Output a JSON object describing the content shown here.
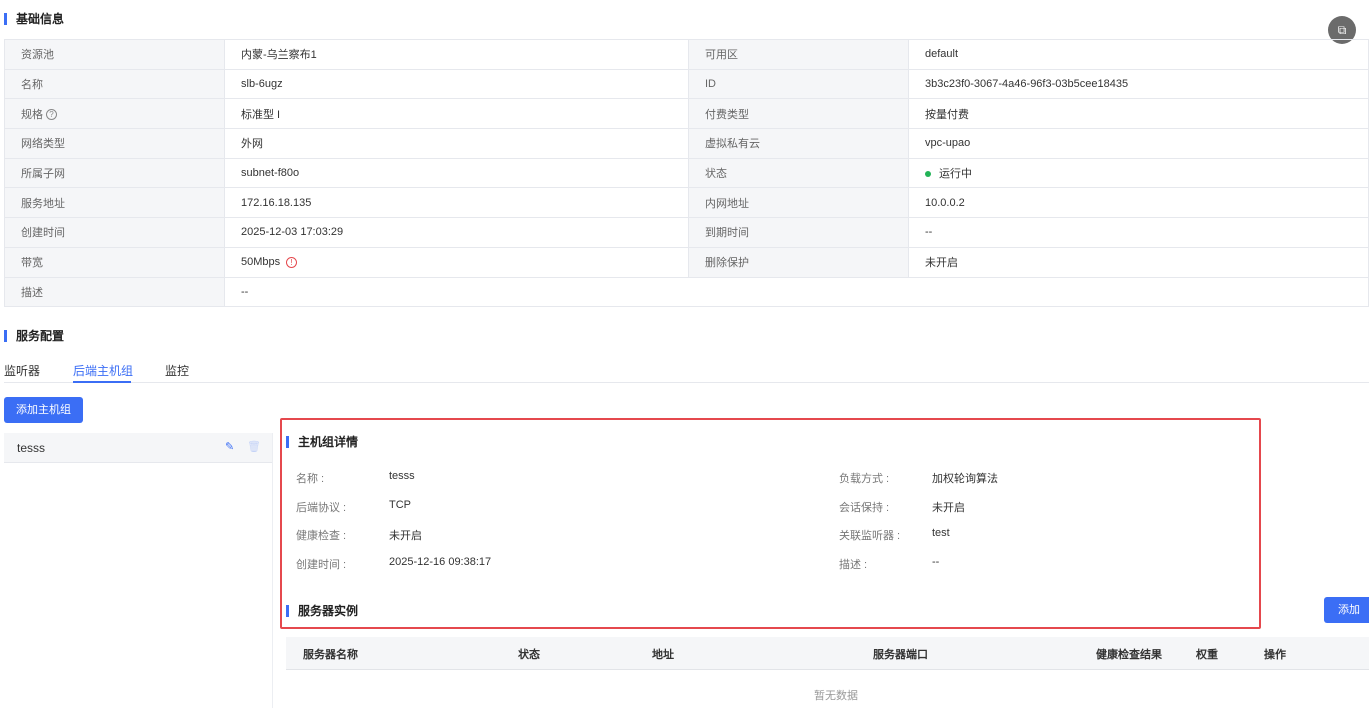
{
  "basic": {
    "title": "基础信息",
    "rows": [
      {
        "l1": "资源池",
        "v1": "内蒙-乌兰察布1",
        "l2": "可用区",
        "v2": "default"
      },
      {
        "l1": "名称",
        "v1": "slb-6ugz",
        "l2": "ID",
        "v2": "3b3c23f0-3067-4a46-96f3-03b5cee18435"
      },
      {
        "l1": "规格",
        "v1": "标准型 I",
        "l2": "付费类型",
        "v2": "按量付费"
      },
      {
        "l1": "网络类型",
        "v1": "外网",
        "l2": "虚拟私有云",
        "v2": "vpc-upao"
      },
      {
        "l1": "所属子网",
        "v1": "subnet-f80o",
        "l2": "状态",
        "v2": "运行中"
      },
      {
        "l1": "服务地址",
        "v1": "172.16.18.135",
        "l2": "内网地址",
        "v2": "10.0.0.2"
      },
      {
        "l1": "创建时间",
        "v1": "2025-12-03 17:03:29",
        "l2": "到期时间",
        "v2": "--"
      },
      {
        "l1": "带宽",
        "v1": "50Mbps",
        "l2": "删除保护",
        "v2": "未开启"
      },
      {
        "l1": "描述",
        "v1": "--"
      }
    ],
    "status_color": "#22b357"
  },
  "service": {
    "title": "服务配置",
    "tabs": [
      "监听器",
      "后端主机组",
      "监控"
    ],
    "active_tab": "后端主机组",
    "add_group_label": "添加主机组",
    "groups": [
      {
        "name": "tesss"
      }
    ]
  },
  "detail": {
    "title": "主机组详情",
    "left": [
      {
        "label": "名称 :",
        "value": "tesss"
      },
      {
        "label": "后端协议 :",
        "value": "TCP"
      },
      {
        "label": "健康检查 :",
        "value": "未开启"
      },
      {
        "label": "创建时间 :",
        "value": "2025-12-16 09:38:17"
      }
    ],
    "right": [
      {
        "label": "负载方式 :",
        "value": "加权轮询算法"
      },
      {
        "label": "会话保持 :",
        "value": "未开启"
      },
      {
        "label": "关联监听器 :",
        "value": "test"
      },
      {
        "label": "描述 :",
        "value": "--"
      }
    ]
  },
  "instances": {
    "title": "服务器实例",
    "add_label": "添加",
    "columns": [
      "服务器名称",
      "状态",
      "地址",
      "服务器端口",
      "健康检查结果",
      "权重",
      "操作"
    ],
    "empty_text": "暂无数据"
  },
  "accent": "#3b6ef5",
  "highlight_color": "#e5484d"
}
